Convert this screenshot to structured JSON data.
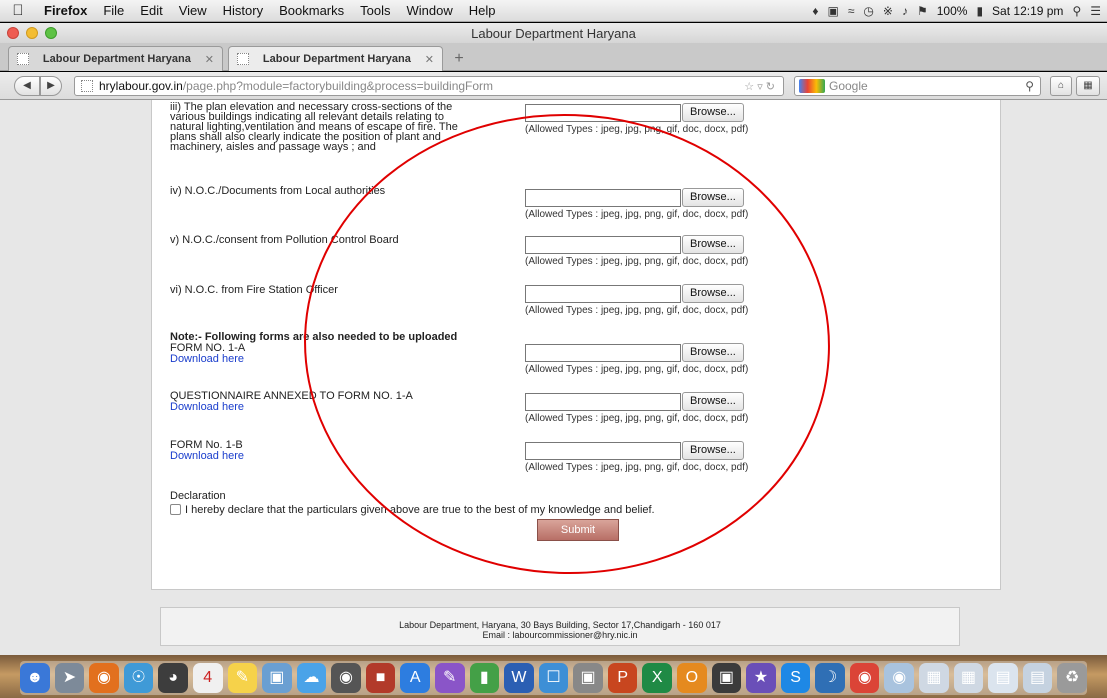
{
  "menubar": {
    "app": "Firefox",
    "items": [
      "File",
      "Edit",
      "View",
      "History",
      "Bookmarks",
      "Tools",
      "Window",
      "Help"
    ],
    "battery": "100%",
    "clock": "Sat 12:19 pm"
  },
  "window": {
    "title": "Labour Department Haryana"
  },
  "tabs": [
    {
      "label": "Labour Department Haryana"
    },
    {
      "label": "Labour Department Haryana"
    }
  ],
  "nav": {
    "url_host": "hrylabour.gov.in",
    "url_path": "/page.php?module=factorybuilding&process=buildingForm",
    "search_placeholder": "Google"
  },
  "form": {
    "browse_label": "Browse...",
    "allowed_types": "(Allowed Types : jpeg, jpg, png, gif, doc, docx, pdf)",
    "item_iii": "iii) The plan elevation and necessary cross-sections of the various buildings indicating all relevant details relating to natural lighting,ventilation and means of escape of fire. The plans shall also clearly indicate the position of plant and machinery, aisles and passage ways ; and",
    "item_iv": "iv) N.O.C./Documents from Local authorities",
    "item_v": "v) N.O.C./consent from Pollution Control Board",
    "item_vi": "vi) N.O.C. from Fire Station Officer",
    "note": "Note:- Following forms are also needed to be uploaded",
    "form_1a": "FORM NO. 1-A",
    "questionnaire": "QUESTIONNAIRE ANNEXED TO FORM NO. 1-A",
    "form_1b": "FORM No. 1-B",
    "download_label": "Download here",
    "declaration_heading": "Declaration",
    "declaration_text": "I hereby declare that the particulars given above are true to the best of my knowledge and belief.",
    "submit_label": "Submit"
  },
  "footer": {
    "line1": "Labour Department, Haryana, 30 Bays Building, Sector 17,Chandigarh - 160 017",
    "line2": "Email : labourcommissioner@hry.nic.in"
  },
  "annotation": {
    "color": "#e00000"
  }
}
